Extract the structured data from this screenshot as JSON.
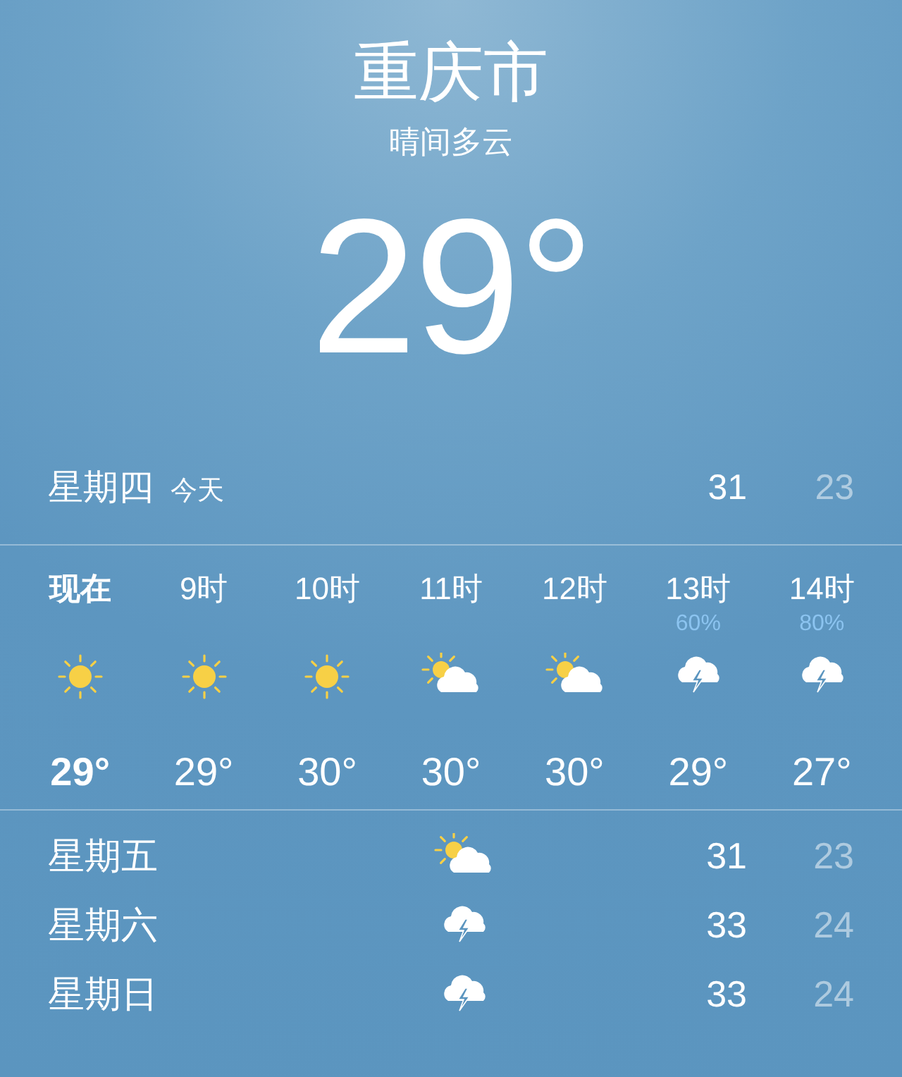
{
  "location": {
    "city": "重庆市",
    "condition": "晴间多云",
    "temperature": "29°"
  },
  "today": {
    "day": "星期四",
    "label": "今天",
    "high": "31",
    "low": "23"
  },
  "hourly": [
    {
      "time": "现在",
      "current": true,
      "kind": "sun",
      "temp": "29°"
    },
    {
      "time": "9时",
      "current": false,
      "kind": "sun",
      "temp": "29°"
    },
    {
      "time": "10时",
      "current": false,
      "kind": "sun",
      "temp": "30°"
    },
    {
      "time": "11时",
      "current": false,
      "kind": "partly-cloudy",
      "temp": "30°"
    },
    {
      "time": "12时",
      "current": false,
      "kind": "partly-cloudy",
      "temp": "30°"
    },
    {
      "time": "13时",
      "current": false,
      "kind": "thunderstorm",
      "precip": "60%",
      "temp": "29°"
    },
    {
      "time": "14时",
      "current": false,
      "kind": "thunderstorm",
      "precip": "80%",
      "temp": "27°"
    }
  ],
  "daily": [
    {
      "day": "星期五",
      "kind": "partly-cloudy",
      "high": "31",
      "low": "23"
    },
    {
      "day": "星期六",
      "kind": "thunderstorm",
      "high": "33",
      "low": "24"
    },
    {
      "day": "星期日",
      "kind": "thunderstorm",
      "high": "33",
      "low": "24"
    }
  ]
}
